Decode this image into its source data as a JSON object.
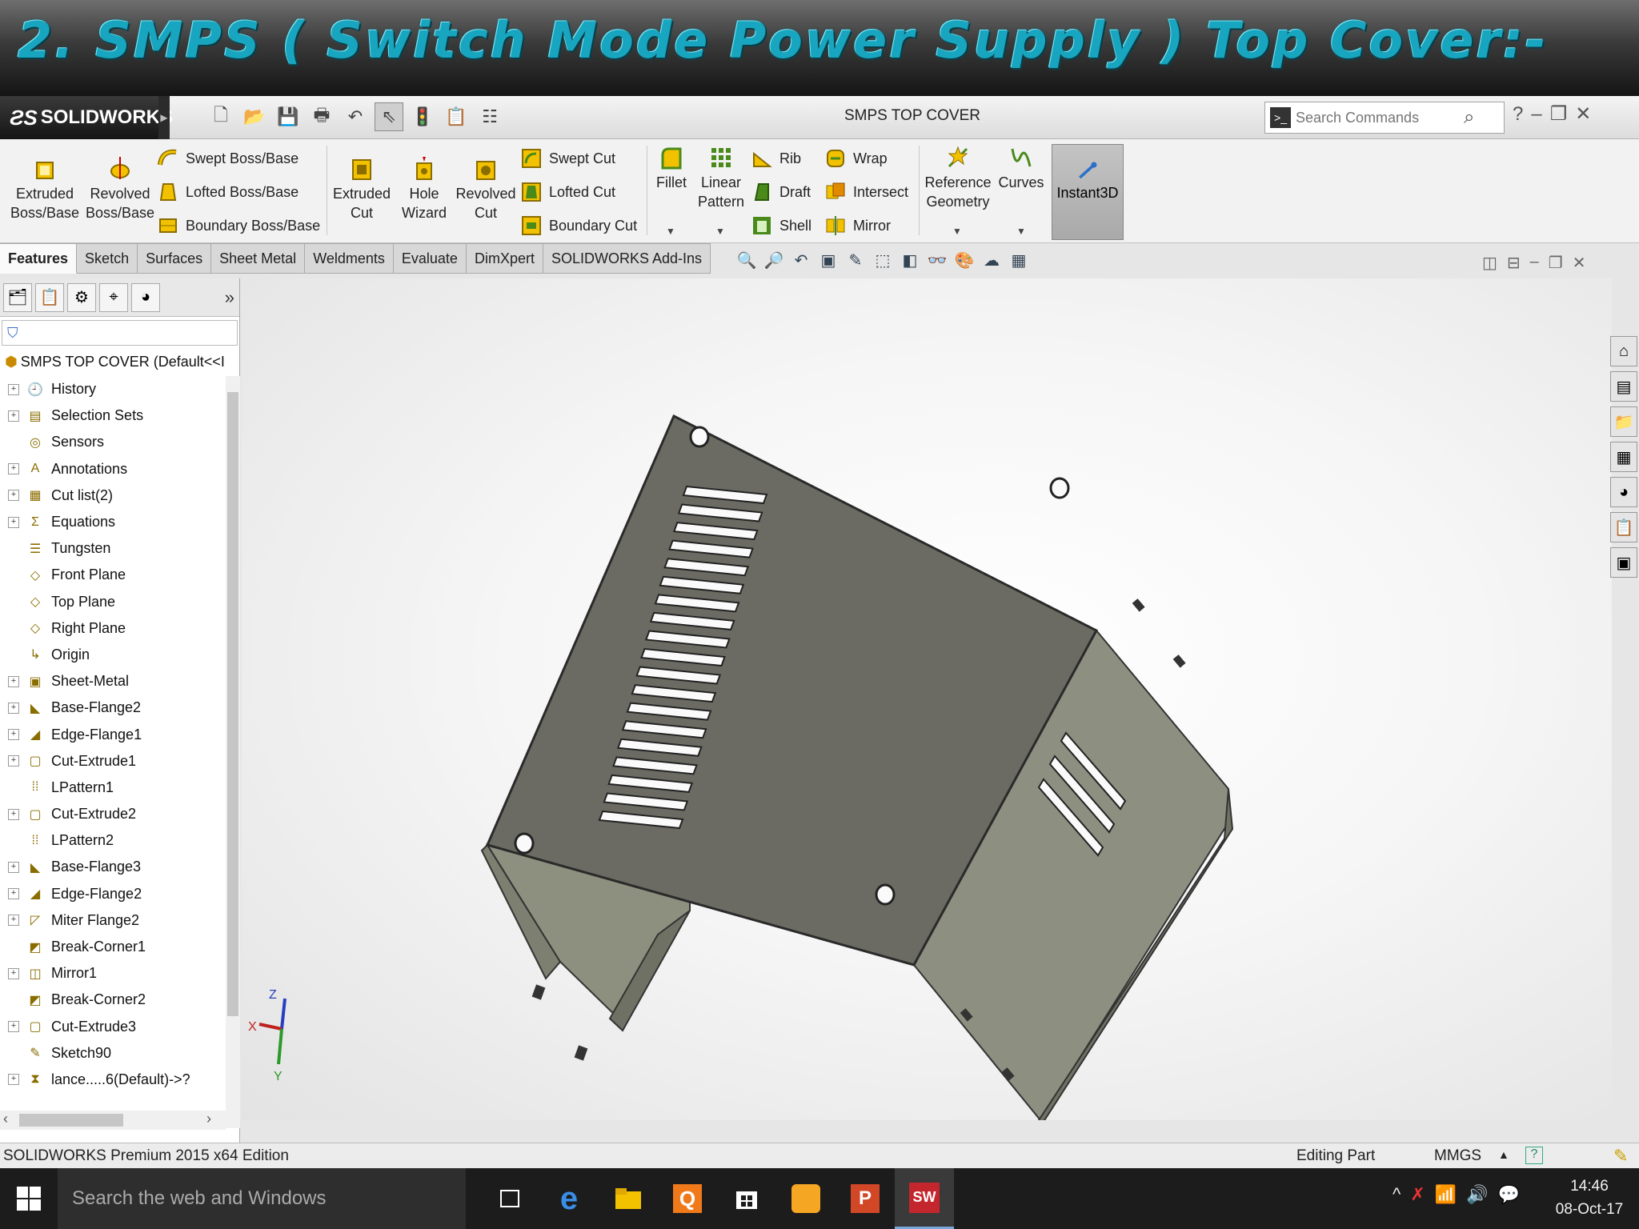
{
  "slide": {
    "title": "2.  SMPS ( Switch Mode Power Supply ) Top Cover:-"
  },
  "app": {
    "brand": "SOLIDWORKS",
    "document_title": "SMPS TOP COVER",
    "search_placeholder": "Search Commands"
  },
  "ribbon": {
    "extruded_boss": [
      "Extruded",
      "Boss/Base"
    ],
    "revolved_boss": [
      "Revolved",
      "Boss/Base"
    ],
    "swept_boss": "Swept Boss/Base",
    "lofted_boss": "Lofted Boss/Base",
    "boundary_boss": "Boundary Boss/Base",
    "extruded_cut": [
      "Extruded",
      "Cut"
    ],
    "hole_wizard": [
      "Hole",
      "Wizard"
    ],
    "revolved_cut": [
      "Revolved",
      "Cut"
    ],
    "swept_cut": "Swept Cut",
    "lofted_cut": "Lofted Cut",
    "boundary_cut": "Boundary Cut",
    "fillet": "Fillet",
    "linear_pattern": [
      "Linear",
      "Pattern"
    ],
    "rib": "Rib",
    "draft": "Draft",
    "shell": "Shell",
    "wrap": "Wrap",
    "intersect": "Intersect",
    "mirror": "Mirror",
    "reference_geometry": [
      "Reference",
      "Geometry"
    ],
    "curves": "Curves",
    "instant3d": "Instant3D"
  },
  "tabs": [
    "Features",
    "Sketch",
    "Surfaces",
    "Sheet Metal",
    "Weldments",
    "Evaluate",
    "DimXpert",
    "SOLIDWORKS Add-Ins"
  ],
  "feature_tree": {
    "root": "SMPS TOP COVER  (Default<<I",
    "items": [
      {
        "label": "History",
        "icon": "history-icon",
        "expand": true
      },
      {
        "label": "Selection Sets",
        "icon": "selection-sets-icon",
        "expand": true
      },
      {
        "label": "Sensors",
        "icon": "sensors-icon",
        "expand": false
      },
      {
        "label": "Annotations",
        "icon": "annotations-icon",
        "expand": true
      },
      {
        "label": "Cut list(2)",
        "icon": "cut-list-icon",
        "expand": true
      },
      {
        "label": "Equations",
        "icon": "equations-icon",
        "expand": true
      },
      {
        "label": "Tungsten",
        "icon": "material-icon",
        "expand": false
      },
      {
        "label": "Front Plane",
        "icon": "plane-icon",
        "expand": false
      },
      {
        "label": "Top Plane",
        "icon": "plane-icon",
        "expand": false
      },
      {
        "label": "Right Plane",
        "icon": "plane-icon",
        "expand": false
      },
      {
        "label": "Origin",
        "icon": "origin-icon",
        "expand": false
      },
      {
        "label": "Sheet-Metal",
        "icon": "sheet-metal-icon",
        "expand": true
      },
      {
        "label": "Base-Flange2",
        "icon": "base-flange-icon",
        "expand": true
      },
      {
        "label": "Edge-Flange1",
        "icon": "edge-flange-icon",
        "expand": true
      },
      {
        "label": "Cut-Extrude1",
        "icon": "cut-extrude-icon",
        "expand": true
      },
      {
        "label": "LPattern1",
        "icon": "linear-pattern-icon",
        "expand": false
      },
      {
        "label": "Cut-Extrude2",
        "icon": "cut-extrude-icon",
        "expand": true
      },
      {
        "label": "LPattern2",
        "icon": "linear-pattern-icon",
        "expand": false
      },
      {
        "label": "Base-Flange3",
        "icon": "base-flange-icon",
        "expand": true
      },
      {
        "label": "Edge-Flange2",
        "icon": "edge-flange-icon",
        "expand": true
      },
      {
        "label": "Miter Flange2",
        "icon": "miter-flange-icon",
        "expand": true
      },
      {
        "label": "Break-Corner1",
        "icon": "break-corner-icon",
        "expand": false
      },
      {
        "label": "Mirror1",
        "icon": "mirror-icon",
        "expand": true
      },
      {
        "label": "Break-Corner2",
        "icon": "break-corner-icon",
        "expand": false
      },
      {
        "label": "Cut-Extrude3",
        "icon": "cut-extrude-icon",
        "expand": true
      },
      {
        "label": "Sketch90",
        "icon": "sketch-icon",
        "expand": false
      },
      {
        "label": "lance.....6(Default)->?",
        "icon": "forming-tool-icon",
        "expand": true
      }
    ]
  },
  "triad": {
    "x": "X",
    "y": "Y",
    "z": "Z"
  },
  "status": {
    "edition": "SOLIDWORKS Premium 2015 x64 Edition",
    "mode": "Editing Part",
    "units": "MMGS"
  },
  "taskbar": {
    "search_placeholder": "Search the web and Windows",
    "time": "14:46",
    "date": "08-Oct-17"
  },
  "colors": {
    "title_text": "#17a5bf",
    "part_top": "#6b6b63",
    "part_side": "#8d8f80",
    "accent_yellow": "#f2c200"
  }
}
